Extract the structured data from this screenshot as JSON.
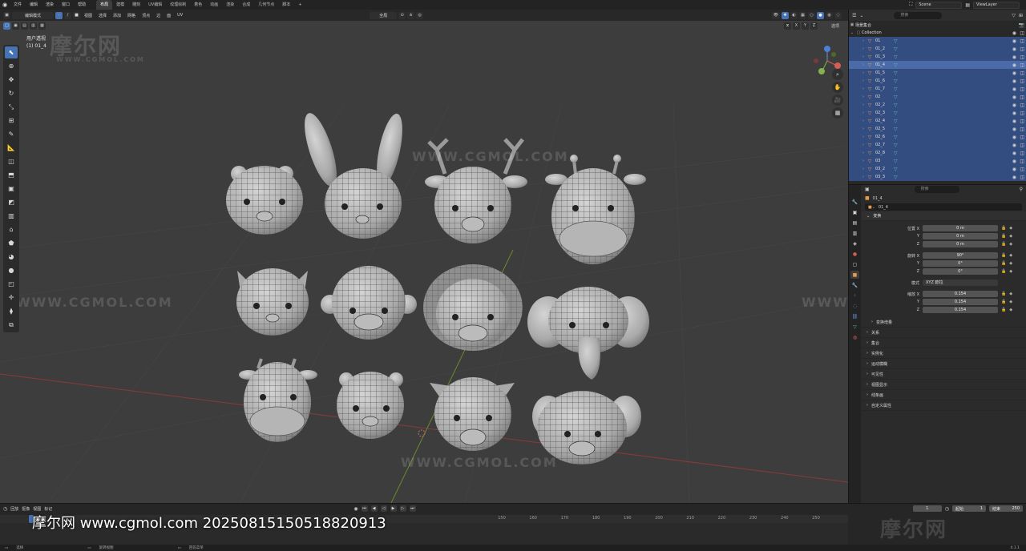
{
  "topbar": {
    "menus": [
      "文件",
      "编辑",
      "渲染",
      "窗口",
      "帮助"
    ],
    "workspaces": [
      "布局",
      "建模",
      "雕刻",
      "UV编辑",
      "纹理绘制",
      "着色",
      "动画",
      "渲染",
      "合成",
      "几何节点",
      "脚本"
    ],
    "active_workspace_index": 0,
    "add_tab": "+",
    "scene": "Scene",
    "view_layer": "ViewLayer"
  },
  "viewport": {
    "mode": "编辑模式",
    "menus": [
      "视图",
      "选择",
      "添加",
      "网格",
      "顶点",
      "边",
      "面",
      "UV"
    ],
    "transform_orientation": "全局",
    "axis_labels": [
      "X",
      "Y",
      "Z"
    ],
    "options": "选项",
    "view_name": "用户透视",
    "object_name": "(1) 01_4"
  },
  "watermarks": {
    "logo_text": "摩尔网",
    "url_text": "WWW.CGMOL.COM"
  },
  "outliner": {
    "search_placeholder": "搜索",
    "title": "场景集合",
    "collection": "Collection",
    "items": [
      "01",
      "01_2",
      "01_3",
      "01_4",
      "01_5",
      "01_6",
      "01_7",
      "02",
      "02_2",
      "02_3",
      "02_4",
      "02_5",
      "02_6",
      "02_7",
      "02_8",
      "03",
      "03_2",
      "03_3"
    ]
  },
  "properties": {
    "search_placeholder": "搜索",
    "object_name": "01_4",
    "data_name": "01_4",
    "panel_transform": "变换",
    "location_label": "位置 X",
    "location": [
      "0 m",
      "0 m",
      "0 m"
    ],
    "rotation_label": "旋转 X",
    "rotation": [
      "90°",
      "0°",
      "0°"
    ],
    "mode_label": "模式",
    "mode_value": "XYZ 欧拉",
    "scale_label": "缩放 X",
    "scale": [
      "0.154",
      "0.154",
      "0.154"
    ],
    "axis_y": "Y",
    "axis_z": "Z",
    "delta_transform": "变换增量",
    "sub_panels": [
      "关系",
      "集合",
      "实例化",
      "运动模糊",
      "可见性",
      "视图显示",
      "线条画",
      "自定义属性"
    ]
  },
  "timeline": {
    "menus": [
      "回放",
      "抠像",
      "视图",
      "标记"
    ],
    "current_frame": "1",
    "start_label": "起始",
    "start_frame": "1",
    "end_label": "结束",
    "end_frame": "250",
    "ticks": [
      "150",
      "160",
      "170",
      "180",
      "190",
      "200",
      "210",
      "220",
      "230",
      "240",
      "250"
    ]
  },
  "statusbar": {
    "items": [
      "选择",
      "旋转视图",
      "回答菜单"
    ],
    "version": "4.1.1"
  },
  "overlay": {
    "text": "摩尔网 www.cgmol.com 20250815150518820913"
  },
  "colors": {
    "accent": "#4772b3",
    "selected_row": "#334d80",
    "mesh_icon": "#e49a4f",
    "modifier_icon": "#5fbfbf",
    "viewport_bg": "#3d3d3d"
  }
}
